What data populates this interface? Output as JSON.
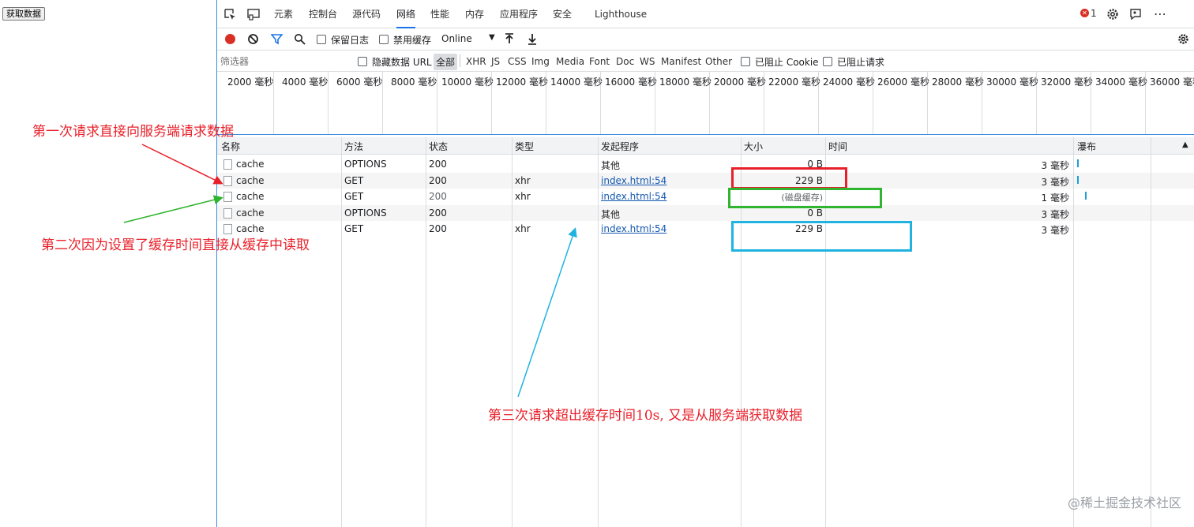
{
  "page": {
    "fetch_button": "获取数据"
  },
  "tabs": [
    "元素",
    "控制台",
    "源代码",
    "网络",
    "性能",
    "内存",
    "应用程序",
    "安全",
    "Lighthouse"
  ],
  "active_tab": "网络",
  "error_count": "1",
  "toolbar": {
    "preserve_log": "保留日志",
    "disable_cache": "禁用缓存",
    "throttle": "Online"
  },
  "filter": {
    "placeholder": "筛选器",
    "hide_data_url": "隐藏数据 URL",
    "all": "全部",
    "types": [
      "XHR",
      "JS",
      "CSS",
      "Img",
      "Media",
      "Font",
      "Doc",
      "WS",
      "Manifest",
      "Other"
    ],
    "blocked_cookies": "已阻止 Cookie",
    "blocked_requests": "已阻止请求"
  },
  "overview_ticks": [
    "2000 毫秒",
    "4000 毫秒",
    "6000 毫秒",
    "8000 毫秒",
    "10000 毫秒",
    "12000 毫秒",
    "14000 毫秒",
    "16000 毫秒",
    "18000 毫秒",
    "20000 毫秒",
    "22000 毫秒",
    "24000 毫秒",
    "26000 毫秒",
    "28000 毫秒",
    "30000 毫秒",
    "32000 毫秒",
    "34000 毫秒",
    "36000 毫秒"
  ],
  "columns": {
    "name": "名称",
    "method": "方法",
    "status": "状态",
    "type": "类型",
    "initiator": "发起程序",
    "size": "大小",
    "time": "时间",
    "waterfall": "瀑布",
    "sort_arrow": "▲"
  },
  "rows": [
    {
      "name": "cache",
      "method": "OPTIONS",
      "status": "200",
      "type": "",
      "initiator": "其他",
      "size": "0 B",
      "time": "3 毫秒"
    },
    {
      "name": "cache",
      "method": "GET",
      "status": "200",
      "type": "xhr",
      "initiator": "index.html:54",
      "size": "229 B",
      "time": "3 毫秒"
    },
    {
      "name": "cache",
      "method": "GET",
      "status": "200",
      "type": "xhr",
      "initiator": "index.html:54",
      "size": "(磁盘缓存)",
      "time": "1 毫秒"
    },
    {
      "name": "cache",
      "method": "OPTIONS",
      "status": "200",
      "type": "",
      "initiator": "其他",
      "size": "0 B",
      "time": "3 毫秒"
    },
    {
      "name": "cache",
      "method": "GET",
      "status": "200",
      "type": "xhr",
      "initiator": "index.html:54",
      "size": "229 B",
      "time": "3 毫秒"
    }
  ],
  "annotations": {
    "first": "第一次请求直接向服务端请求数据",
    "second": "第二次因为设置了缓存时间直接从缓存中读取",
    "third": "第三次请求超出缓存时间10s, 又是从服务端获取数据",
    "colors": {
      "red": "#e8202a",
      "green": "#2fb52f",
      "cyan": "#1fb3e0"
    }
  },
  "watermark": "@稀土掘金技术社区"
}
